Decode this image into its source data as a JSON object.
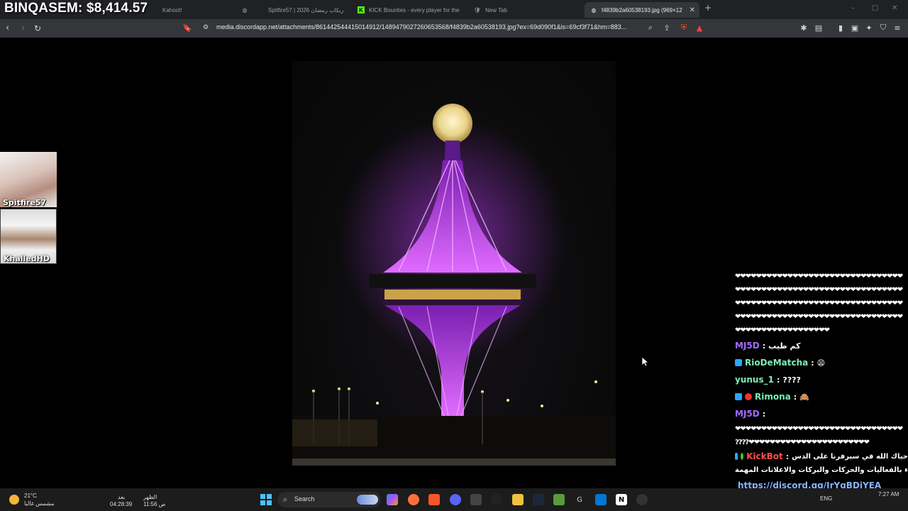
{
  "overlay": {
    "title": "BINQASEM: $8,414.57"
  },
  "tabs": [
    {
      "label": "Kahoot!",
      "icon": "kahoot-icon"
    },
    {
      "label": "Spitfire57 | 2026 ريكاب رمضان",
      "icon": "globe-icon"
    },
    {
      "label": "KICK Bounties - every player for the",
      "icon": "kick-icon"
    },
    {
      "label": "New Tab",
      "icon": "brave-icon"
    },
    {
      "label": "f4839b2a60538193.jpg (969×12",
      "icon": "globe-icon",
      "active": true
    }
  ],
  "toolbar": {
    "url": "media.discordapp.net/attachments/861442544415014912/1489479027260653568/f4839b2a60538193.jpg?ex=69d090f1&is=69cf3f71&hm=883..."
  },
  "cams": [
    {
      "label": "Spitfire57"
    },
    {
      "label": "KhalledHD"
    }
  ],
  "chat": {
    "spam_lines": [
      "❤❤❤❤❤❤❤❤❤❤❤❤❤❤❤❤❤❤❤❤❤❤❤❤❤❤❤❤❤❤❤❤",
      "❤❤❤❤❤❤❤❤❤❤❤❤❤❤❤❤❤❤❤❤❤❤❤❤❤❤❤❤❤❤❤❤",
      "❤❤❤❤❤❤❤❤❤❤❤❤❤❤❤❤❤❤❤❤❤❤❤❤❤❤❤❤❤❤❤❤",
      "❤❤❤❤❤❤❤❤❤❤❤❤❤❤❤❤❤❤❤❤❤❤❤❤❤❤❤❤❤❤❤❤",
      "❤❤❤❤❤❤❤❤❤❤❤❤❤❤❤❤❤❤"
    ],
    "messages": [
      {
        "user": "MJ5D",
        "color": "#a56bff",
        "text": "كم طيب"
      },
      {
        "user": "RioDeMatcha",
        "color": "#7cf0b6",
        "text": "😩"
      },
      {
        "user": "yunus_1",
        "color": "#7cf0b6",
        "text": "????"
      },
      {
        "user": "Rimona",
        "color": "#7cf0b6",
        "text": "🙈"
      },
      {
        "user": "MJ5D",
        "color": "#a56bff",
        "text": ""
      }
    ],
    "spam2": [
      "❤❤❤❤❤❤❤❤❤❤❤❤❤❤❤❤❤❤❤❤❤❤❤❤❤❤❤❤❤❤❤❤",
      "????❤❤❤❤❤❤❤❤❤❤❤❤❤❤❤❤❤❤❤❤❤❤❤"
    ],
    "bot": {
      "user": "KickBot",
      "color": "#ff4d4d",
      "line1": "حياك الله في سيرفرنا على الدس",
      "line2": "المليء بالفعاليات والحركات والبركات والاعلانات المهمة:",
      "link": "https://discord.gg/JrYqBDjYEA"
    },
    "last": {
      "user": "yunus_1",
      "color": "#7cf0b6"
    }
  },
  "taskbar": {
    "weather_temp": "21°C",
    "weather_desc": "مشمس غالبا",
    "timer_label": "بعد",
    "timer_value": "04:28:39",
    "prayer_label": "الظهر",
    "prayer_time": "11:56 ص",
    "search_label": "Search",
    "lang": "ENG",
    "clock": "7:27 AM"
  }
}
